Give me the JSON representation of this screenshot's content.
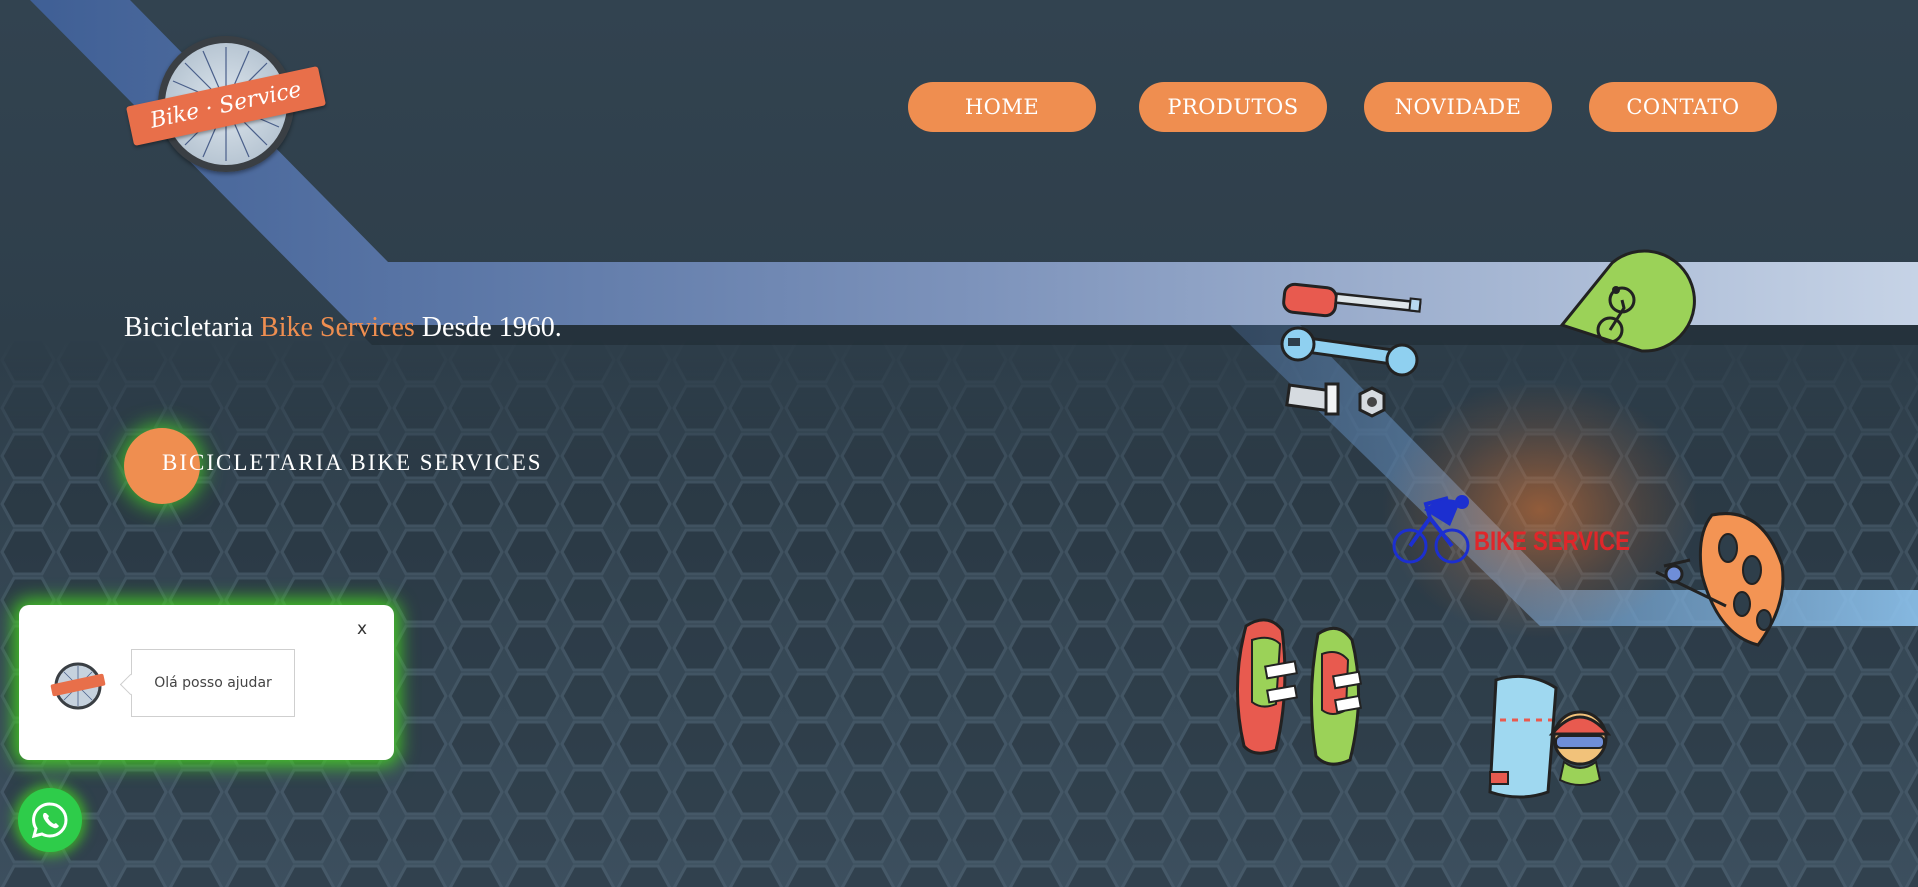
{
  "logo": {
    "text": "Bike · Service"
  },
  "nav": {
    "items": [
      {
        "label": "HOME"
      },
      {
        "label": "PRODUTOS"
      },
      {
        "label": "NOVIDADE"
      },
      {
        "label": "CONTATO"
      }
    ]
  },
  "hero": {
    "headline_prefix": "Bicicletaria ",
    "headline_accent": "Bike Services",
    "headline_suffix": " Desde 1960.",
    "cta_label": "BICICLETARIA BIKE SERVICES"
  },
  "chat": {
    "close_label": "x",
    "message": "Olá posso ajudar",
    "avatar_text": "Bike Service"
  },
  "illustration": {
    "brand_label": "BIKE SERVICE"
  },
  "colors": {
    "accent": "#ef8e50",
    "glow": "#46d21e",
    "whatsapp": "#2ecc4a",
    "brand_red": "#e0262a"
  },
  "icons": [
    "bike-wheel-icon",
    "whatsapp-icon",
    "screwdriver-icon",
    "wrench-icon",
    "bolt-nut-icon",
    "location-pin-bike-icon",
    "cyclist-icon",
    "helmet-icon",
    "pump-icon",
    "cycling-shoes-icon",
    "cyclist-avatar-icon",
    "jersey-icon"
  ]
}
